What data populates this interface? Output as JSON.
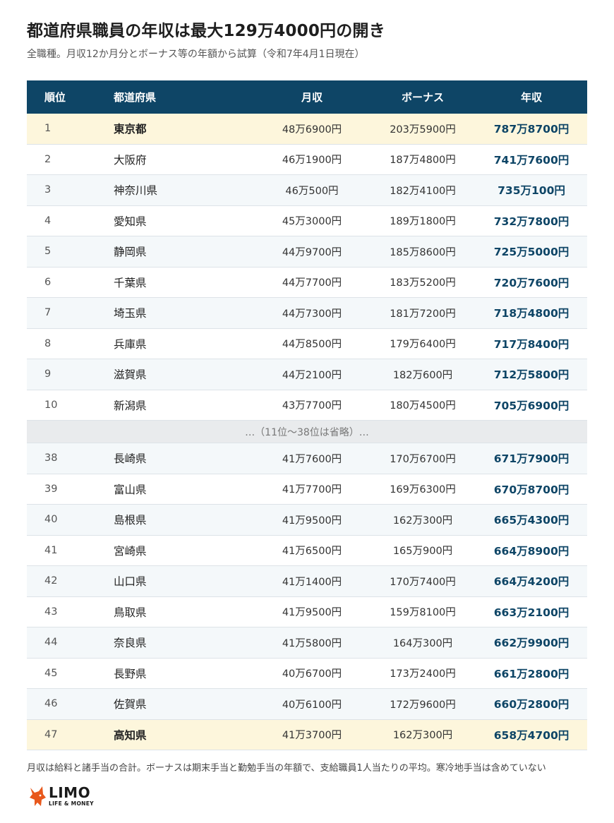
{
  "title": "都道府県職員の年収は最大129万4000円の開き",
  "subtitle": "全職種。月収12か月分とボーナス等の年額から試算（令和7年4月1日現在）",
  "table": {
    "headers": {
      "rank": "順位",
      "prefecture": "都道府県",
      "monthly": "月収",
      "bonus": "ボーナス",
      "annual": "年収"
    },
    "top_rows": [
      {
        "rank": "1",
        "prefecture": "東京都",
        "monthly": "48万6900円",
        "bonus": "203万5900円",
        "annual": "787万8700円"
      },
      {
        "rank": "2",
        "prefecture": "大阪府",
        "monthly": "46万1900円",
        "bonus": "187万4800円",
        "annual": "741万7600円"
      },
      {
        "rank": "3",
        "prefecture": "神奈川県",
        "monthly": "46万500円",
        "bonus": "182万4100円",
        "annual": "735万100円"
      },
      {
        "rank": "4",
        "prefecture": "愛知県",
        "monthly": "45万3000円",
        "bonus": "189万1800円",
        "annual": "732万7800円"
      },
      {
        "rank": "5",
        "prefecture": "静岡県",
        "monthly": "44万9700円",
        "bonus": "185万8600円",
        "annual": "725万5000円"
      },
      {
        "rank": "6",
        "prefecture": "千葉県",
        "monthly": "44万7700円",
        "bonus": "183万5200円",
        "annual": "720万7600円"
      },
      {
        "rank": "7",
        "prefecture": "埼玉県",
        "monthly": "44万7300円",
        "bonus": "181万7200円",
        "annual": "718万4800円"
      },
      {
        "rank": "8",
        "prefecture": "兵庫県",
        "monthly": "44万8500円",
        "bonus": "179万6400円",
        "annual": "717万8400円"
      },
      {
        "rank": "9",
        "prefecture": "滋賀県",
        "monthly": "44万2100円",
        "bonus": "182万600円",
        "annual": "712万5800円"
      },
      {
        "rank": "10",
        "prefecture": "新潟県",
        "monthly": "43万7700円",
        "bonus": "180万4500円",
        "annual": "705万6900円"
      }
    ],
    "omitted_note": "…（11位〜38位は省略）…",
    "bottom_rows": [
      {
        "rank": "38",
        "prefecture": "長崎県",
        "monthly": "41万7600円",
        "bonus": "170万6700円",
        "annual": "671万7900円"
      },
      {
        "rank": "39",
        "prefecture": "富山県",
        "monthly": "41万7700円",
        "bonus": "169万6300円",
        "annual": "670万8700円"
      },
      {
        "rank": "40",
        "prefecture": "島根県",
        "monthly": "41万9500円",
        "bonus": "162万300円",
        "annual": "665万4300円"
      },
      {
        "rank": "41",
        "prefecture": "宮崎県",
        "monthly": "41万6500円",
        "bonus": "165万900円",
        "annual": "664万8900円"
      },
      {
        "rank": "42",
        "prefecture": "山口県",
        "monthly": "41万1400円",
        "bonus": "170万7400円",
        "annual": "664万4200円"
      },
      {
        "rank": "43",
        "prefecture": "鳥取県",
        "monthly": "41万9500円",
        "bonus": "159万8100円",
        "annual": "663万2100円"
      },
      {
        "rank": "44",
        "prefecture": "奈良県",
        "monthly": "41万5800円",
        "bonus": "164万300円",
        "annual": "662万9900円"
      },
      {
        "rank": "45",
        "prefecture": "長野県",
        "monthly": "40万6700円",
        "bonus": "173万2400円",
        "annual": "661万2800円"
      },
      {
        "rank": "46",
        "prefecture": "佐賀県",
        "monthly": "40万6100円",
        "bonus": "172万9600円",
        "annual": "660万2800円"
      },
      {
        "rank": "47",
        "prefecture": "高知県",
        "monthly": "41万3700円",
        "bonus": "162万300円",
        "annual": "658万4700円"
      }
    ]
  },
  "footnote": "月収は給料と諸手当の合計。ボーナスは期末手当と勤勉手当の年額で、支給職員1人当たりの平均。寒冷地手当は含めていない",
  "logo": {
    "name": "LIMO",
    "tagline": "LIFE & MONEY",
    "icon": "fox-icon",
    "accent_color": "#e8581c"
  },
  "colors": {
    "header_bg": "#0e4566",
    "highlight_bg": "#fdf6dc",
    "annual_text": "#0e4566"
  }
}
